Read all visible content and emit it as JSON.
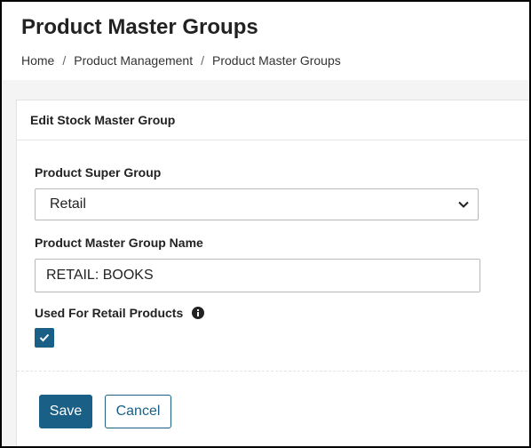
{
  "header": {
    "title": "Product Master Groups",
    "breadcrumb": [
      "Home",
      "Product Management",
      "Product Master Groups"
    ],
    "breadcrumb_separator": "/"
  },
  "card": {
    "title": "Edit Stock Master Group"
  },
  "form": {
    "super_group": {
      "label": "Product Super Group",
      "value": "Retail"
    },
    "group_name": {
      "label": "Product Master Group Name",
      "value": "RETAIL: BOOKS"
    },
    "retail_products": {
      "label": "Used For Retail Products",
      "checked": true,
      "info_icon": "info-icon"
    }
  },
  "actions": {
    "save_label": "Save",
    "cancel_label": "Cancel"
  },
  "colors": {
    "primary": "#1a5f86"
  }
}
